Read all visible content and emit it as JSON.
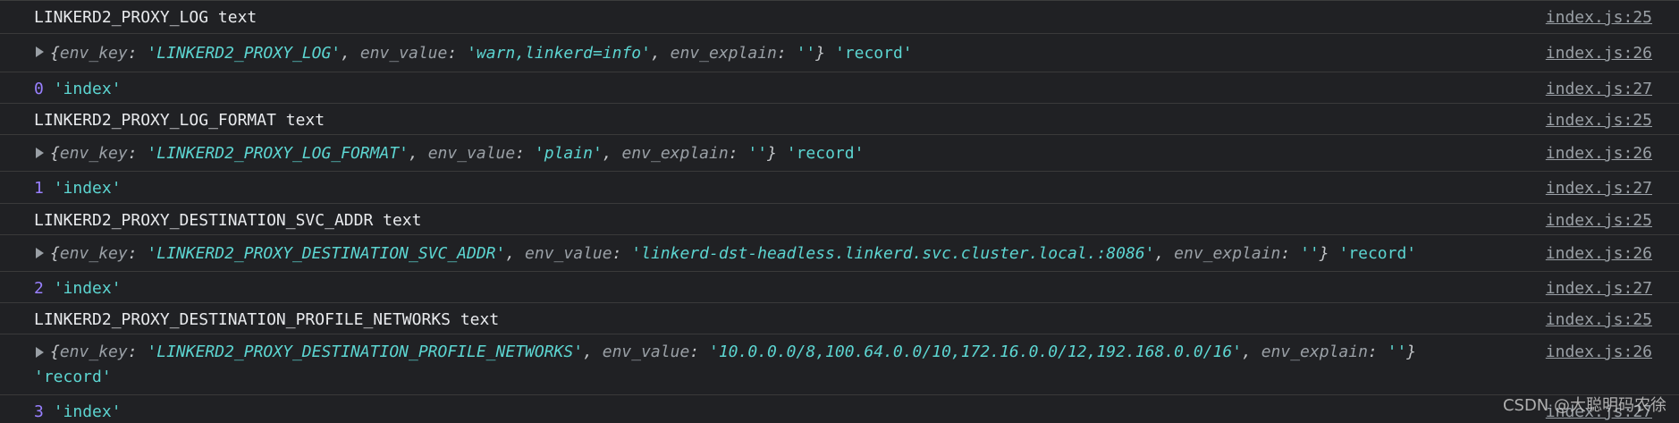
{
  "rows": [
    {
      "type": "text",
      "msg": "LINKERD2_PROXY_LOG text",
      "src": "index.js:25"
    },
    {
      "type": "obj",
      "key_label": "env_key",
      "key_value": "'LINKERD2_PROXY_LOG'",
      "value_label": "env_value",
      "value_value": "'warn,linkerd=info'",
      "explain_label": "env_explain",
      "explain_value": "''",
      "tail": "'record'",
      "src": "index.js:26"
    },
    {
      "type": "index",
      "num": "0",
      "str": "'index'",
      "src": "index.js:27"
    },
    {
      "type": "text",
      "msg": "LINKERD2_PROXY_LOG_FORMAT text",
      "src": "index.js:25"
    },
    {
      "type": "obj",
      "key_label": "env_key",
      "key_value": "'LINKERD2_PROXY_LOG_FORMAT'",
      "value_label": "env_value",
      "value_value": "'plain'",
      "explain_label": "env_explain",
      "explain_value": "''",
      "tail": "'record'",
      "src": "index.js:26"
    },
    {
      "type": "index",
      "num": "1",
      "str": "'index'",
      "src": "index.js:27"
    },
    {
      "type": "text",
      "msg": "LINKERD2_PROXY_DESTINATION_SVC_ADDR text",
      "src": "index.js:25"
    },
    {
      "type": "obj",
      "key_label": "env_key",
      "key_value": "'LINKERD2_PROXY_DESTINATION_SVC_ADDR'",
      "value_label": "env_value",
      "value_value": "'linkerd-dst-headless.linkerd.svc.cluster.local.:8086'",
      "explain_label": "env_explain",
      "explain_value": "''",
      "tail": "'record'",
      "src": "index.js:26"
    },
    {
      "type": "index",
      "num": "2",
      "str": "'index'",
      "src": "index.js:27"
    },
    {
      "type": "text",
      "msg": "LINKERD2_PROXY_DESTINATION_PROFILE_NETWORKS text",
      "src": "index.js:25"
    },
    {
      "type": "obj",
      "key_label": "env_key",
      "key_value": "'LINKERD2_PROXY_DESTINATION_PROFILE_NETWORKS'",
      "value_label": "env_value",
      "value_value": "'10.0.0.0/8,100.64.0.0/10,172.16.0.0/12,192.168.0.0/16'",
      "explain_label": "env_explain",
      "explain_value": "''",
      "tail": "'record'",
      "src": "index.js:26"
    },
    {
      "type": "index",
      "num": "3",
      "str": "'index'",
      "src": "index.js:27"
    }
  ],
  "watermark": "CSDN @大聪明码农徐",
  "colors": {
    "background": "#202124",
    "string": "#5cd5d1",
    "number": "#9980ff",
    "key": "#9aa0a6"
  },
  "icons": {
    "expand": "triangle-right-icon"
  }
}
